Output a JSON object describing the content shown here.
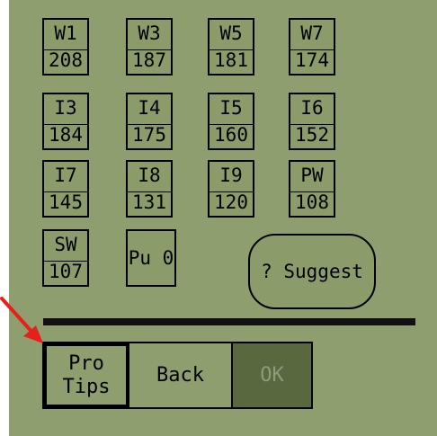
{
  "clubs": [
    {
      "id": "w1",
      "name": "W1",
      "distance": "208"
    },
    {
      "id": "w3",
      "name": "W3",
      "distance": "187"
    },
    {
      "id": "w5",
      "name": "W5",
      "distance": "181"
    },
    {
      "id": "w7",
      "name": "W7",
      "distance": "174"
    },
    {
      "id": "i3",
      "name": "I3",
      "distance": "184"
    },
    {
      "id": "i4",
      "name": "I4",
      "distance": "175"
    },
    {
      "id": "i5",
      "name": "I5",
      "distance": "160"
    },
    {
      "id": "i6",
      "name": "I6",
      "distance": "152"
    },
    {
      "id": "i7",
      "name": "I7",
      "distance": "145"
    },
    {
      "id": "i8",
      "name": "I8",
      "distance": "131"
    },
    {
      "id": "i9",
      "name": "I9",
      "distance": "120"
    },
    {
      "id": "pw",
      "name": "PW",
      "distance": "108"
    },
    {
      "id": "sw",
      "name": "SW",
      "distance": "107"
    }
  ],
  "putter": {
    "label": "Pu 0"
  },
  "suggest": {
    "label": "? Suggest"
  },
  "buttons": {
    "pro_tips": "Pro\nTips",
    "back": "Back",
    "ok": "OK"
  },
  "colors": {
    "screen": "#8f9e6f",
    "disabled": "#59683f",
    "annotation_arrow": "#e8201c"
  },
  "annotation": {
    "icon": "arrow-icon"
  }
}
